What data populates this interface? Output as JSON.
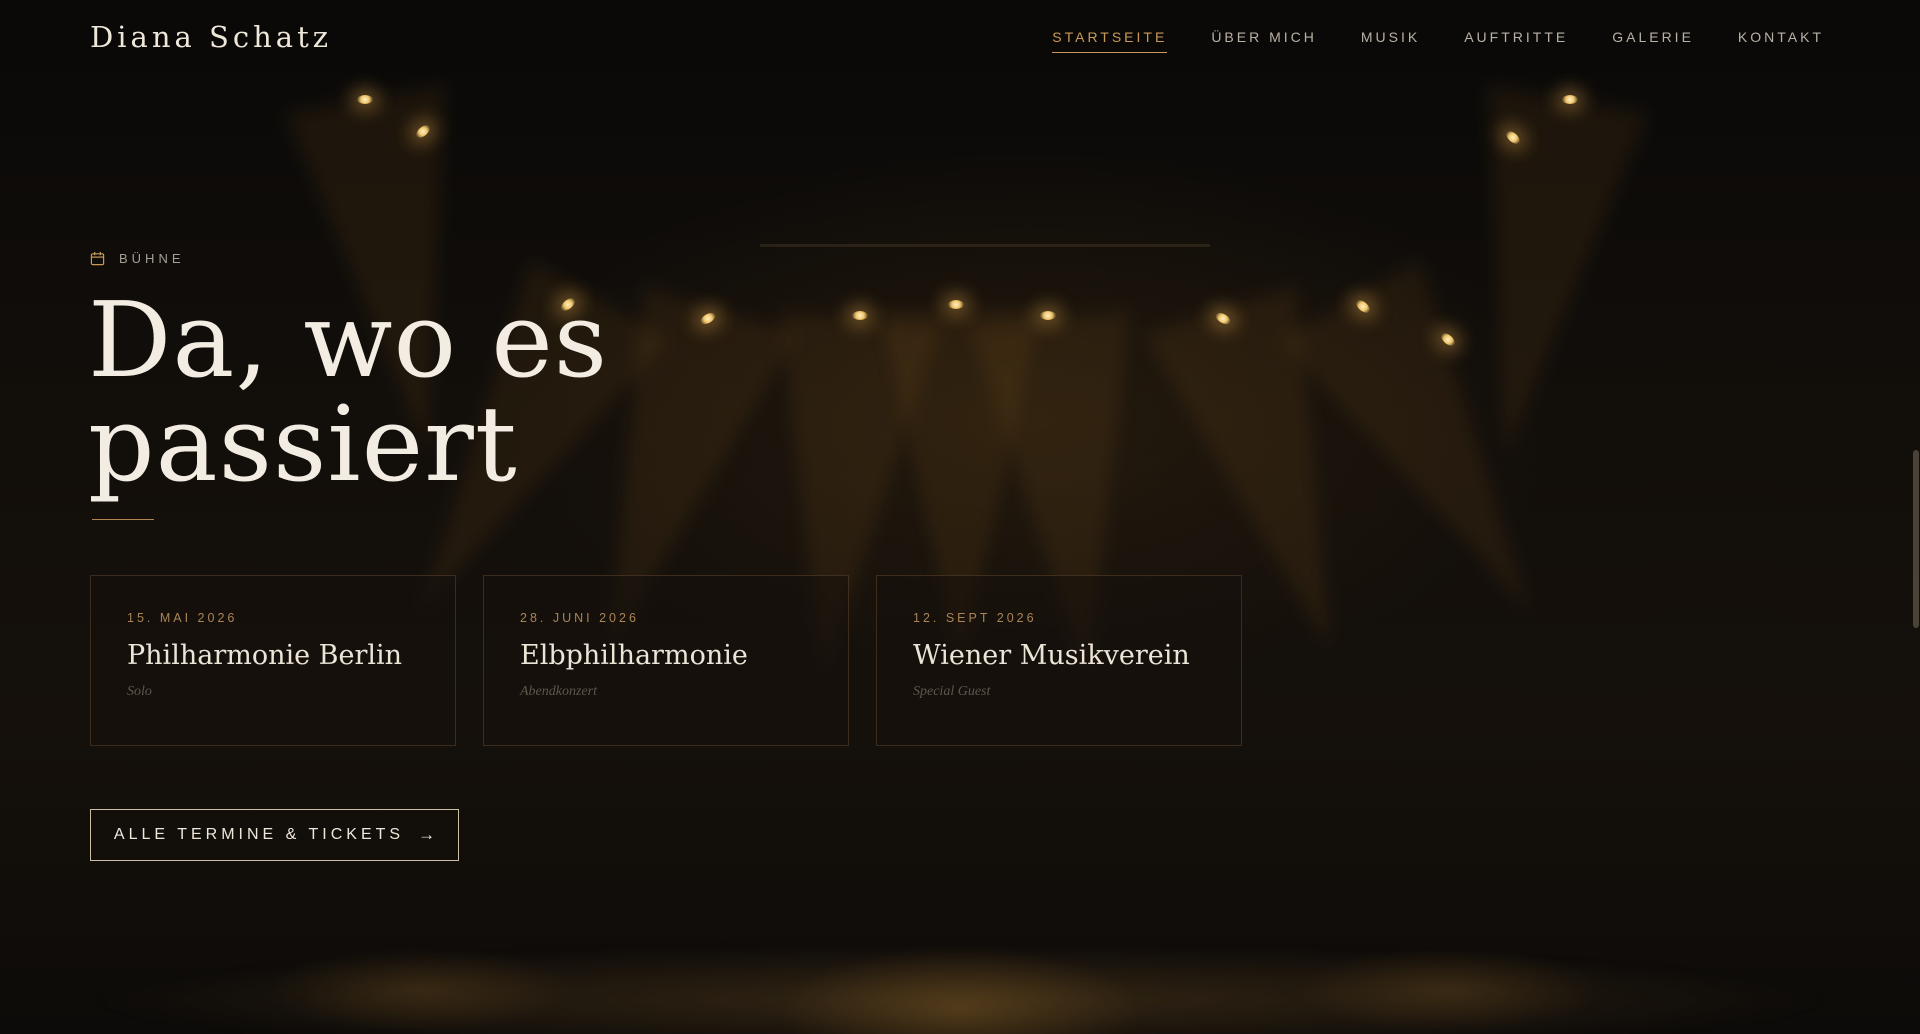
{
  "header": {
    "brand": "Diana Schatz",
    "nav": [
      {
        "label": "STARTSEITE",
        "active": true
      },
      {
        "label": "ÜBER MICH",
        "active": false
      },
      {
        "label": "MUSIK",
        "active": false
      },
      {
        "label": "AUFTRITTE",
        "active": false
      },
      {
        "label": "GALERIE",
        "active": false
      },
      {
        "label": "KONTAKT",
        "active": false
      }
    ]
  },
  "hero": {
    "eyebrow_icon": "calendar-icon",
    "eyebrow": "BÜHNE",
    "headline_line1": "Da, wo es",
    "headline_line2": "passiert"
  },
  "events": [
    {
      "date": "15. MAI 2026",
      "venue": "Philharmonie Berlin",
      "type": "Solo"
    },
    {
      "date": "28. JUNI 2026",
      "venue": "Elbphilharmonie",
      "type": "Abendkonzert"
    },
    {
      "date": "12. SEPT 2026",
      "venue": "Wiener Musikverein",
      "type": "Special Guest"
    }
  ],
  "cta": {
    "label": "ALLE TERMINE & TICKETS",
    "icon": "arrow-right-icon"
  },
  "colors": {
    "accent": "#c99a57",
    "text": "#f2ece2",
    "background": "#0c0a08"
  }
}
